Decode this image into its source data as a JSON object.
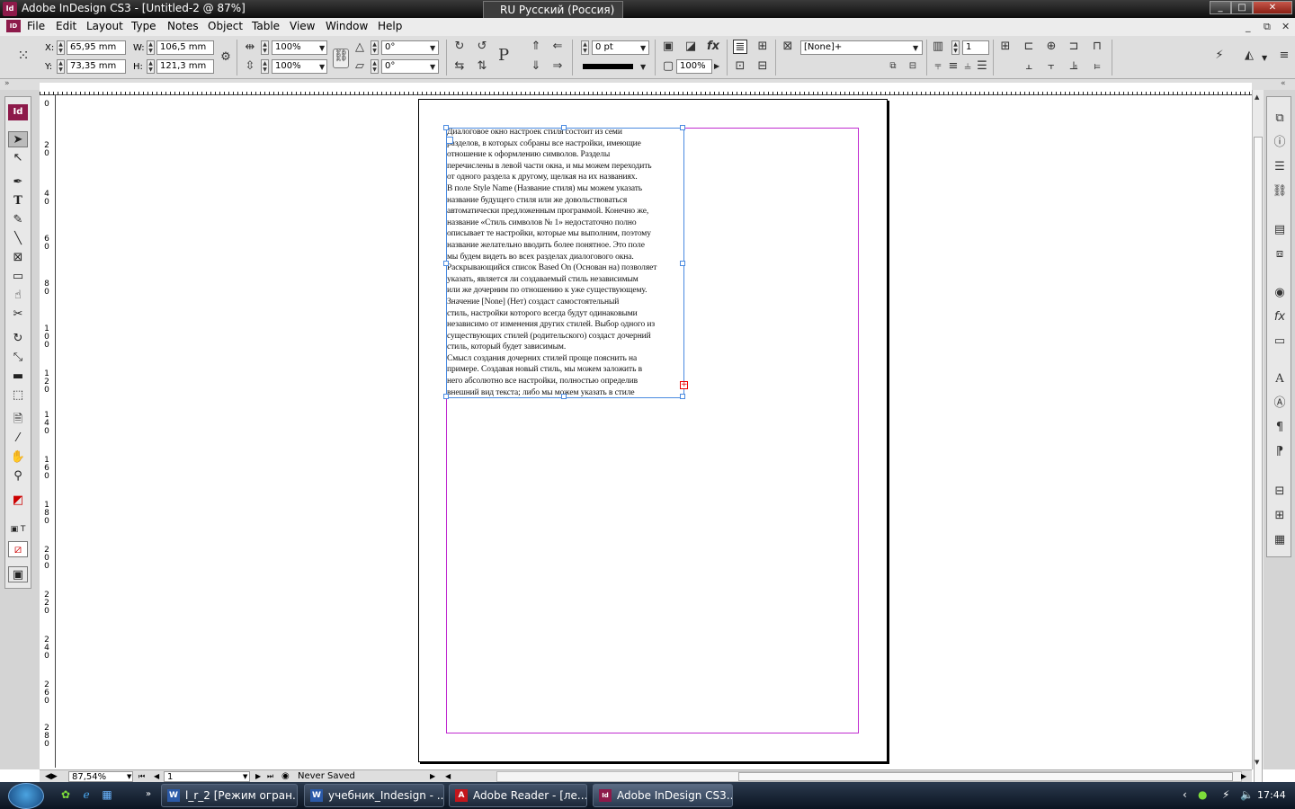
{
  "window": {
    "title": "Adobe InDesign CS3 - [Untitled-2 @ 87%]",
    "app_icon": "Id",
    "language_indicator": "RU Русский (Россия)",
    "controls": [
      "_",
      "□",
      "✕"
    ]
  },
  "menubar": {
    "app_icon": "ID",
    "items": [
      "File",
      "Edit",
      "Layout",
      "Type",
      "Notes",
      "Object",
      "Table",
      "View",
      "Window",
      "Help"
    ],
    "doc_controls": [
      "_",
      "⧉",
      "✕"
    ]
  },
  "control_panel": {
    "x_label": "X:",
    "x_value": "65,95 mm",
    "y_label": "Y:",
    "y_value": "73,35 mm",
    "w_label": "W:",
    "w_value": "106,5 mm",
    "h_label": "H:",
    "h_value": "121,3 mm",
    "scale_x": "100%",
    "scale_y": "100%",
    "rotation": "0°",
    "shear": "0°",
    "stroke_weight": "0 pt",
    "opacity": "100%",
    "object_style": "[None]+",
    "columns": "1"
  },
  "ruler_left_labels": [
    "0",
    "2\n0",
    "4\n0",
    "6\n0",
    "8\n0",
    "1\n0\n0",
    "1\n2\n0",
    "1\n4\n0",
    "1\n6\n0",
    "1\n8\n0",
    "2\n0\n0",
    "2\n2\n0",
    "2\n4\n0",
    "2\n6\n0",
    "2\n8\n0"
  ],
  "document": {
    "story_text": "Диалоговое окно настроек стиля состоит из семи\nразделов, в которых собраны все настройки, имеющие\nотношение к оформлению символов. Разделы\nперечислены в левой части окна, и мы можем переходить\nот одного раздела к другому, щелкая на их названиях.\nВ поле Style Name (Название стиля) мы можем указать\nназвание будущего стиля или же довольствоваться\nавтоматически предложенным программой. Конечно же,\nназвание «Стиль символов № 1» недостаточно полно\nописывает те настройки, которые мы выполним, поэтому\nназвание желательно вводить более понятное. Это поле\nмы будем видеть во всех разделах диалогового окна.\nРаскрывающийся список Based On (Основан на) позволяет\nуказать, является ли создаваемый стиль независимым\nили же дочерним по отношению к уже существующему.\nЗначение [None] (Нет) создаст самостоятельный\nстиль, настройки которого всегда будут одинаковыми\nнезависимо от изменения других стилей. Выбор одного из\nсуществующих стилей (родительского) создаст дочерний\nстиль, который будет зависимым.\nСмысл создания дочерних стилей проще пояснить на\nпримере. Создавая новый стиль, мы можем заложить в\nнего абсолютно все настройки, полностью определив\nвнешний вид текста; либо мы можем указать в стиле",
    "overset_marker": "+"
  },
  "statusbar": {
    "zoom": "87,54%",
    "page": "1",
    "save_status": "Never Saved"
  },
  "taskbar": {
    "buttons": [
      {
        "label": "l_r_2 [Режим огран...",
        "icon": "W"
      },
      {
        "label": "учебник_Indesign - ...",
        "icon": "W"
      },
      {
        "label": "Adobe Reader - [ле...",
        "icon": "A"
      },
      {
        "label": "Adobe InDesign CS3...",
        "icon": "Id"
      }
    ],
    "clock": "17:44"
  },
  "colors": {
    "indesign_brand": "#8d1a4a",
    "margin_guide": "#c02bd0",
    "frame_selection": "#4a8ae0",
    "overset": "#e00000"
  }
}
